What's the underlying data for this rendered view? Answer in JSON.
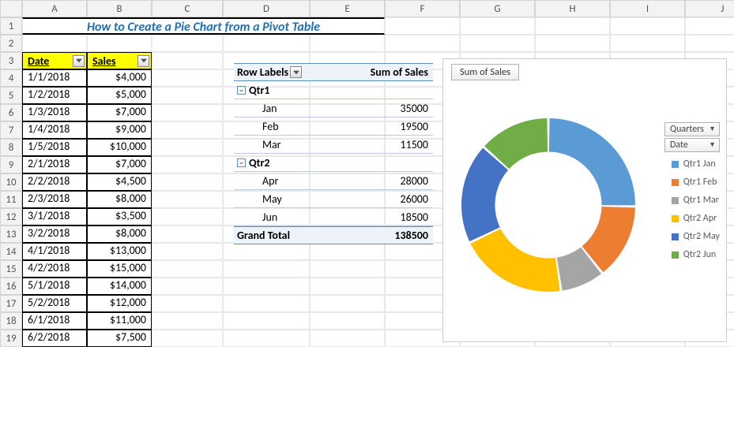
{
  "title": "How to Create a Pie Chart from a Pivot Table",
  "columns": [
    "A",
    "B",
    "C",
    "D",
    "E",
    "F",
    "G",
    "H",
    "I",
    "J"
  ],
  "data_table": {
    "headers": {
      "date": "Date",
      "sales": "Sales"
    },
    "rows": [
      {
        "date": "1/1/2018",
        "sales": "$4,000"
      },
      {
        "date": "1/2/2018",
        "sales": "$5,000"
      },
      {
        "date": "1/3/2018",
        "sales": "$7,000"
      },
      {
        "date": "1/4/2018",
        "sales": "$9,000"
      },
      {
        "date": "1/5/2018",
        "sales": "$10,000"
      },
      {
        "date": "2/1/2018",
        "sales": "$7,000"
      },
      {
        "date": "2/2/2018",
        "sales": "$4,500"
      },
      {
        "date": "2/3/2018",
        "sales": "$8,000"
      },
      {
        "date": "3/1/2018",
        "sales": "$3,500"
      },
      {
        "date": "3/2/2018",
        "sales": "$8,000"
      },
      {
        "date": "4/1/2018",
        "sales": "$13,000"
      },
      {
        "date": "4/2/2018",
        "sales": "$15,000"
      },
      {
        "date": "5/1/2018",
        "sales": "$14,000"
      },
      {
        "date": "5/2/2018",
        "sales": "$12,000"
      },
      {
        "date": "6/1/2018",
        "sales": "$11,000"
      },
      {
        "date": "6/2/2018",
        "sales": "$7,500"
      }
    ]
  },
  "pivot": {
    "row_labels_header": "Row Labels",
    "value_header": "Sum of Sales",
    "groups": [
      {
        "group": "Qtr1",
        "items": [
          {
            "label": "Jan",
            "value": "35000"
          },
          {
            "label": "Feb",
            "value": "19500"
          },
          {
            "label": "Mar",
            "value": "11500"
          }
        ]
      },
      {
        "group": "Qtr2",
        "items": [
          {
            "label": "Apr",
            "value": "28000"
          },
          {
            "label": "May",
            "value": "26000"
          },
          {
            "label": "Jun",
            "value": "18500"
          }
        ]
      }
    ],
    "grand_total_label": "Grand Total",
    "grand_total_value": "138500"
  },
  "chart": {
    "title_button": "Sum of Sales",
    "field_buttons": [
      "Quarters",
      "Date"
    ],
    "legend": [
      {
        "label": "Qtr1 Jan",
        "color": "#5b9bd5"
      },
      {
        "label": "Qtr1 Feb",
        "color": "#ed7d31"
      },
      {
        "label": "Qtr1 Mar",
        "color": "#a5a5a5"
      },
      {
        "label": "Qtr2 Apr",
        "color": "#ffc000"
      },
      {
        "label": "Qtr2 May",
        "color": "#4472c4"
      },
      {
        "label": "Qtr2 Jun",
        "color": "#70ad47"
      }
    ]
  },
  "chart_data": {
    "type": "pie",
    "title": "Sum of Sales",
    "categories": [
      "Qtr1 Jan",
      "Qtr1 Feb",
      "Qtr1 Mar",
      "Qtr2 Apr",
      "Qtr2 May",
      "Qtr2 Jun"
    ],
    "values": [
      35000,
      19500,
      11500,
      28000,
      26000,
      18500
    ],
    "colors": [
      "#5b9bd5",
      "#ed7d31",
      "#a5a5a5",
      "#ffc000",
      "#4472c4",
      "#70ad47"
    ]
  }
}
